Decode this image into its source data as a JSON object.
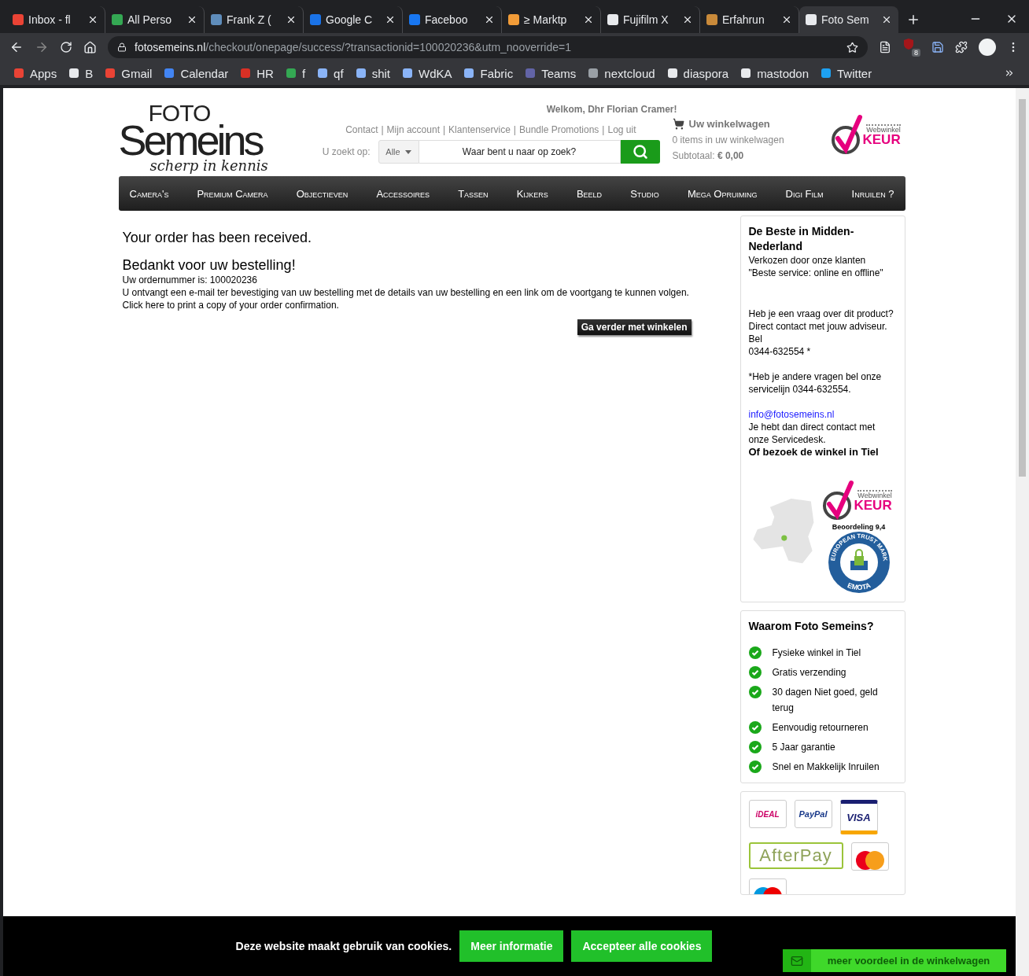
{
  "browser": {
    "tabs": [
      {
        "title": "Inbox - fl",
        "color": "#ea4335",
        "selected": false
      },
      {
        "title": "All Perso",
        "color": "#34a853",
        "selected": false
      },
      {
        "title": "Frank Z (",
        "color": "#5f8dbb",
        "selected": false
      },
      {
        "title": "Google C",
        "color": "#1a73e8",
        "selected": false
      },
      {
        "title": "Faceboo",
        "color": "#1877f2",
        "selected": false
      },
      {
        "title": "≥ Marktp",
        "color": "#f29c38",
        "selected": false
      },
      {
        "title": "Fujifilm X",
        "color": "#e8eaed",
        "selected": false
      },
      {
        "title": "Erfahrun",
        "color": "#c98a3a",
        "selected": false
      },
      {
        "title": "Foto Sem",
        "color": "#e8eaed",
        "selected": true
      }
    ],
    "url": {
      "host": "fotosemeins.nl",
      "path": "/checkout/onepage/success/?transactionid=100020236&utm_nooverride=1"
    },
    "extension_badge": "8",
    "bookmarks": [
      {
        "label": "Apps",
        "color": "#ea4335"
      },
      {
        "label": "B",
        "color": "#e8eaed"
      },
      {
        "label": "Gmail",
        "color": "#ea4335"
      },
      {
        "label": "Calendar",
        "color": "#4285f4"
      },
      {
        "label": "HR",
        "color": "#d93025"
      },
      {
        "label": "f",
        "color": "#34a853"
      },
      {
        "label": "qf",
        "color": "#8ab4f8"
      },
      {
        "label": "shit",
        "color": "#8ab4f8"
      },
      {
        "label": "WdKA",
        "color": "#8ab4f8"
      },
      {
        "label": "Fabric",
        "color": "#8ab4f8"
      },
      {
        "label": "Teams",
        "color": "#6264a7"
      },
      {
        "label": "nextcloud",
        "color": "#9aa0a6"
      },
      {
        "label": "diaspora",
        "color": "#e8eaed"
      },
      {
        "label": "mastodon",
        "color": "#e8eaed"
      },
      {
        "label": "Twitter",
        "color": "#1da1f2"
      }
    ]
  },
  "header": {
    "logo": {
      "top": "FOTO",
      "main": "Semeins",
      "tagline": "scherp in kennis"
    },
    "welcome": "Welkom, Dhr Florian Cramer!",
    "links": [
      "Contact",
      "Mijn account",
      "Klantenservice",
      "Bundle Promotions",
      "Log uit"
    ],
    "link_separator": "|",
    "search": {
      "label": "U zoekt op:",
      "category": "Alle",
      "placeholder": "Waar bent u naar op zoek?"
    },
    "cart": {
      "title": "Uw winkelwagen",
      "items": "0 items in uw winkelwagen",
      "subtotal_label": "Subtotaal:",
      "subtotal": "€ 0,00"
    },
    "badge": {
      "top": "Webwinkel",
      "main": "KEUR"
    }
  },
  "nav": [
    "Camera's",
    "Premium Camera",
    "Objectieven",
    "Accessoires",
    "Tassen",
    "Kijkers",
    "Beeld",
    "Studio",
    "Mega Opruiming",
    "Digi Film",
    "Inruilen ?"
  ],
  "order": {
    "title": "Your order has been received.",
    "thanks": "Bedankt voor uw bestelling!",
    "number": "Uw ordernummer is: 100020236",
    "info": "U ontvangt een e-mail ter bevestiging van uw bestelling met de details van uw bestelling en een link om de voortgang te kunnen volgen.",
    "print": "Click here to print a copy of your order confirmation.",
    "continue": "Ga verder met winkelen"
  },
  "sidebar": {
    "contact": {
      "title": "De Beste in Midden-Nederland",
      "paragraphs": [
        [
          {
            "kind": "text",
            "text": "Verkozen door onze klanten"
          },
          {
            "kind": "text",
            "text": "\"Beste service: online en offline\""
          }
        ],
        [
          {
            "kind": "text",
            "text": "Heb je een vraag over dit product?"
          },
          {
            "kind": "text",
            "text": "Direct contact met jouw adviseur."
          },
          {
            "kind": "text",
            "text": "Bel"
          },
          {
            "kind": "text",
            "text": "0344-632554 *"
          }
        ],
        [
          {
            "kind": "text",
            "text": "*Heb je andere vragen bel onze servicelijn 0344-632554."
          }
        ],
        [
          {
            "kind": "link",
            "text": "info@fotosemeins.nl"
          },
          {
            "kind": "text",
            "text": "Je hebt dan direct contact met onze Servicedesk."
          },
          {
            "kind": "strong",
            "text": "Of bezoek de winkel in Tiel"
          }
        ]
      ],
      "badge": {
        "top": "Webwinkel",
        "main": "KEUR",
        "rating": "Beoordeling 9,4"
      },
      "trust": {
        "ring": "EUROPEAN TRUST MARK",
        "bottom": "EMOTA"
      }
    },
    "why": {
      "title": "Waarom Foto Semeins?",
      "items": [
        "Fysieke winkel in Tiel",
        "Gratis verzending",
        "30 dagen Niet goed, geld terug",
        "Eenvoudig retourneren",
        "5 Jaar garantie",
        "Snel en Makkelijk Inruilen"
      ]
    },
    "payments": [
      {
        "kind": "ideal",
        "label": "iDEAL"
      },
      {
        "kind": "paypal",
        "label": "PayPal"
      },
      {
        "kind": "visa",
        "label": "VISA"
      },
      {
        "kind": "afterpay",
        "label": "AfterPay"
      },
      {
        "kind": "mastercard"
      },
      {
        "kind": "maestro"
      }
    ]
  },
  "cookie": {
    "text": "Deze website maakt gebruik van cookies.",
    "buttons": [
      "Meer informatie",
      "Accepteer alle cookies"
    ]
  },
  "promo": "meer voordeel in de winkelwagen"
}
